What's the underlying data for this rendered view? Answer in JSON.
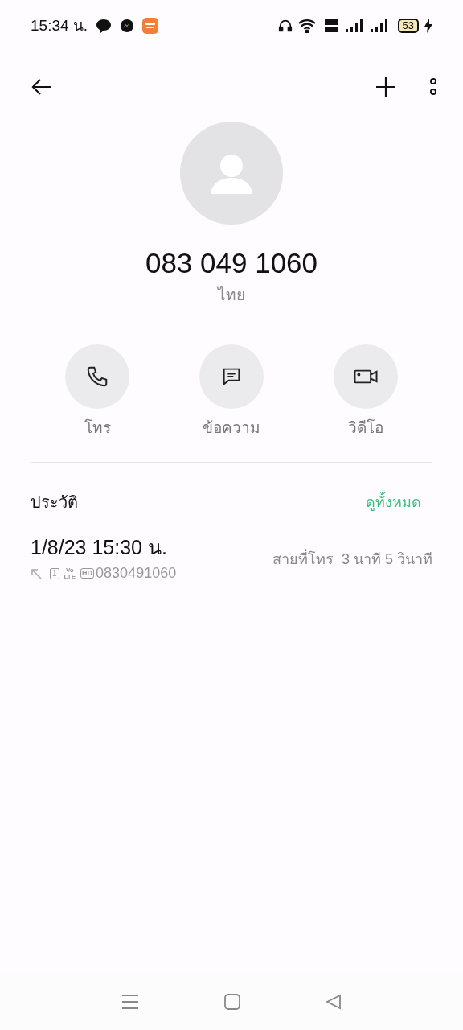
{
  "status_bar": {
    "time": "15:34 น.",
    "battery": "53"
  },
  "contact": {
    "number": "083 049 1060",
    "location": "ไทย"
  },
  "actions": [
    {
      "kind": "call",
      "label": "โทร"
    },
    {
      "kind": "message",
      "label": "ข้อความ"
    },
    {
      "kind": "video",
      "label": "วิดีโอ"
    }
  ],
  "history": {
    "title": "ประวัติ",
    "see_all": "ดูทั้งหมด",
    "entries": [
      {
        "datetime": "1/8/23 15:30 น.",
        "sim": "1",
        "volte": [
          "Vo",
          "LTE"
        ],
        "hd": "HD",
        "number": "0830491060",
        "type": "สายที่โทร",
        "duration": "3 นาที 5 วินาที"
      }
    ]
  }
}
